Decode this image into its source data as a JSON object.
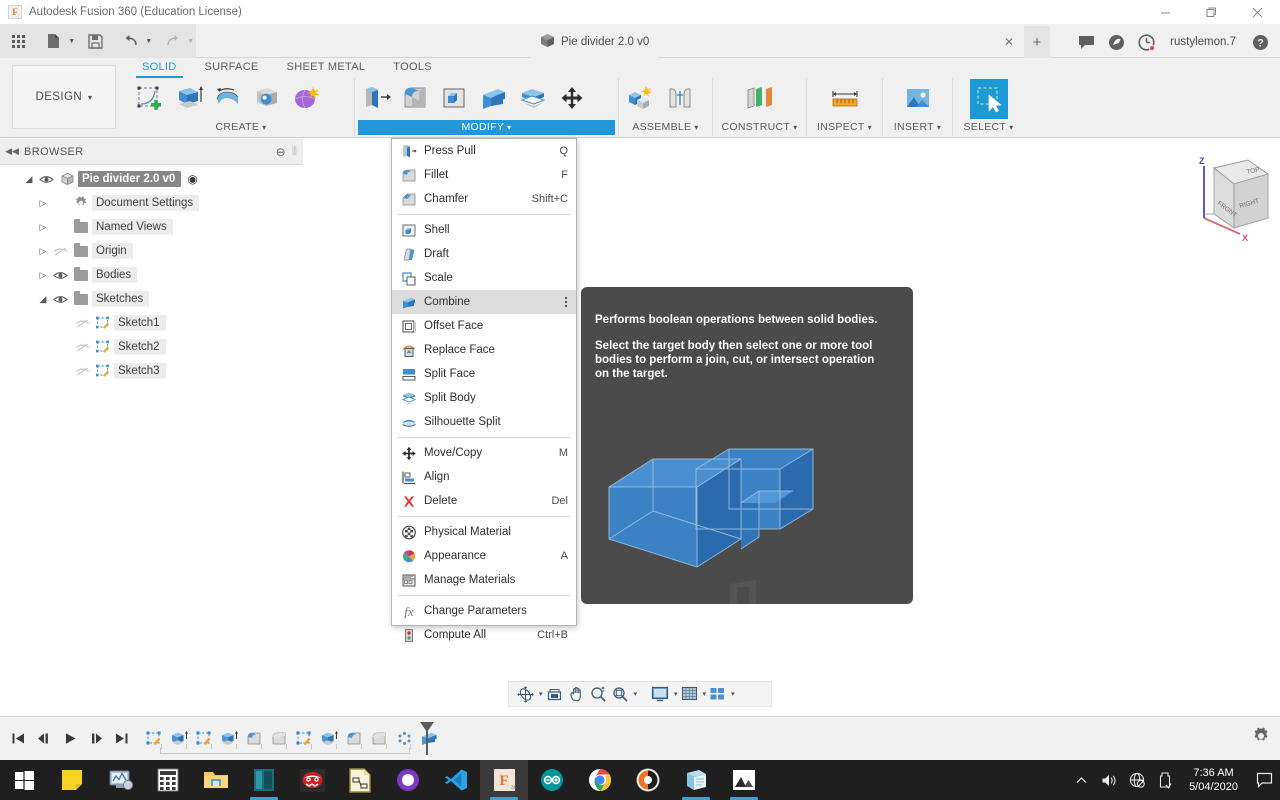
{
  "window": {
    "title": "Autodesk Fusion 360 (Education License)",
    "app_icon": "fusion-logo-icon",
    "minimize": "–",
    "maximize": "❐",
    "close": "✕"
  },
  "quick_access": {
    "app_grid": "app-grid-icon",
    "new_file": "new-file-icon",
    "save": "save-icon",
    "undo": "undo-icon",
    "redo": "redo-icon",
    "caret": "▾"
  },
  "document_tab": {
    "label": "Pie divider 2.0 v0",
    "icon": "component-cube-icon",
    "close": "✕",
    "new_tab": "+"
  },
  "tabbar_right": {
    "comments": "comment-icon",
    "job_status": "job-status-icon",
    "notifications": "notification-clock-icon",
    "user": "rustylemon.7",
    "help": "?"
  },
  "ribbon": {
    "workspace": "DESIGN",
    "workspace_caret": "▾",
    "tabs": [
      {
        "label": "SOLID",
        "active": true
      },
      {
        "label": "SURFACE",
        "active": false
      },
      {
        "label": "SHEET METAL",
        "active": false
      },
      {
        "label": "TOOLS",
        "active": false
      }
    ],
    "panels": [
      {
        "label": "CREATE",
        "caret": "▾",
        "active": false,
        "tools": [
          "create-sketch-icon",
          "extrude-icon",
          "revolve-icon",
          "sweep-icon",
          "form-icon"
        ]
      },
      {
        "label": "MODIFY",
        "caret": "▾",
        "active": true,
        "tools": [
          "press-pull-icon",
          "fillet-icon",
          "shell-icon",
          "combine-icon",
          "split-body-icon",
          "move-copy-icon"
        ]
      },
      {
        "label": "ASSEMBLE",
        "caret": "▾",
        "active": false,
        "tools": [
          "new-component-icon",
          "joint-icon"
        ]
      },
      {
        "label": "CONSTRUCT",
        "caret": "▾",
        "active": false,
        "tools": [
          "offset-plane-icon"
        ]
      },
      {
        "label": "INSPECT",
        "caret": "▾",
        "active": false,
        "tools": [
          "measure-icon"
        ]
      },
      {
        "label": "INSERT",
        "caret": "▾",
        "active": false,
        "tools": [
          "insert-image-icon"
        ]
      },
      {
        "label": "SELECT",
        "caret": "▾",
        "active": false,
        "tools": [
          "select-window-icon"
        ]
      }
    ]
  },
  "browser": {
    "title": "BROWSER",
    "collapse": "◀◀",
    "minus": "⊖",
    "tree": [
      {
        "label": "Pie divider 2.0 v0",
        "arrow": "◢",
        "eye": "visible",
        "icon": "component-cube-icon",
        "indent": 0,
        "root": true,
        "radio": "◉"
      },
      {
        "label": "Document Settings",
        "arrow": "▷",
        "eye": "none",
        "icon": "gear-icon",
        "indent": 1,
        "root": false
      },
      {
        "label": "Named Views",
        "arrow": "▷",
        "eye": "none",
        "icon": "folder-icon",
        "indent": 1,
        "root": false
      },
      {
        "label": "Origin",
        "arrow": "▷",
        "eye": "hidden",
        "icon": "folder-icon",
        "indent": 1,
        "root": false
      },
      {
        "label": "Bodies",
        "arrow": "▷",
        "eye": "visible",
        "icon": "folder-icon",
        "indent": 1,
        "root": false
      },
      {
        "label": "Sketches",
        "arrow": "◢",
        "eye": "visible",
        "icon": "folder-icon",
        "indent": 1,
        "root": false
      },
      {
        "label": "Sketch1",
        "arrow": "",
        "eye": "hidden",
        "icon": "sketch-icon",
        "indent": 2,
        "root": false
      },
      {
        "label": "Sketch2",
        "arrow": "",
        "eye": "hidden",
        "icon": "sketch-icon",
        "indent": 2,
        "root": false
      },
      {
        "label": "Sketch3",
        "arrow": "",
        "eye": "hidden",
        "icon": "sketch-icon",
        "indent": 2,
        "root": false
      }
    ]
  },
  "modify_menu": {
    "items": [
      {
        "label": "Press Pull",
        "shortcut": "Q",
        "icon": "press-pull-icon",
        "sep_after": false,
        "highlighted": false
      },
      {
        "label": "Fillet",
        "shortcut": "F",
        "icon": "fillet-icon",
        "sep_after": false,
        "highlighted": false
      },
      {
        "label": "Chamfer",
        "shortcut": "Shift+C",
        "icon": "chamfer-icon",
        "sep_after": true,
        "highlighted": false
      },
      {
        "label": "Shell",
        "shortcut": "",
        "icon": "shell-icon",
        "sep_after": false,
        "highlighted": false
      },
      {
        "label": "Draft",
        "shortcut": "",
        "icon": "draft-icon",
        "sep_after": false,
        "highlighted": false
      },
      {
        "label": "Scale",
        "shortcut": "",
        "icon": "scale-icon",
        "sep_after": false,
        "highlighted": false
      },
      {
        "label": "Combine",
        "shortcut": "",
        "icon": "combine-icon",
        "sep_after": false,
        "highlighted": true,
        "overflow": "⋮"
      },
      {
        "label": "Offset Face",
        "shortcut": "",
        "icon": "offset-face-icon",
        "sep_after": false,
        "highlighted": false
      },
      {
        "label": "Replace Face",
        "shortcut": "",
        "icon": "replace-face-icon",
        "sep_after": false,
        "highlighted": false
      },
      {
        "label": "Split Face",
        "shortcut": "",
        "icon": "split-face-icon",
        "sep_after": false,
        "highlighted": false
      },
      {
        "label": "Split Body",
        "shortcut": "",
        "icon": "split-body-icon",
        "sep_after": false,
        "highlighted": false
      },
      {
        "label": "Silhouette Split",
        "shortcut": "",
        "icon": "silhouette-split-icon",
        "sep_after": true,
        "highlighted": false
      },
      {
        "label": "Move/Copy",
        "shortcut": "M",
        "icon": "move-copy-icon",
        "sep_after": false,
        "highlighted": false
      },
      {
        "label": "Align",
        "shortcut": "",
        "icon": "align-icon",
        "sep_after": false,
        "highlighted": false
      },
      {
        "label": "Delete",
        "shortcut": "Del",
        "icon": "delete-icon",
        "sep_after": true,
        "highlighted": false
      },
      {
        "label": "Physical Material",
        "shortcut": "",
        "icon": "physical-material-icon",
        "sep_after": false,
        "highlighted": false
      },
      {
        "label": "Appearance",
        "shortcut": "A",
        "icon": "appearance-icon",
        "sep_after": false,
        "highlighted": false
      },
      {
        "label": "Manage Materials",
        "shortcut": "",
        "icon": "manage-materials-icon",
        "sep_after": true,
        "highlighted": false
      },
      {
        "label": "Change Parameters",
        "shortcut": "",
        "icon": "change-parameters-icon",
        "sep_after": false,
        "highlighted": false
      },
      {
        "label": "Compute All",
        "shortcut": "Ctrl+B",
        "icon": "compute-all-icon",
        "sep_after": false,
        "highlighted": false
      }
    ]
  },
  "tooltip": {
    "heading": "Performs boolean operations between solid bodies.",
    "body_line1": "Select the target body then select one or more tool",
    "body_line2": "bodies to perform a join, cut, or intersect operation",
    "body_line3": "on the target.",
    "preview_alt": "combine-preview-illustration"
  },
  "viewcube": {
    "top": "TOP",
    "front": "FRONT",
    "right": "RIGHT",
    "axis_z": "Z",
    "axis_x": "X"
  },
  "navbar": {
    "items": [
      {
        "name": "orbit-icon",
        "caret": "▾"
      },
      {
        "name": "look-at-icon",
        "caret": ""
      },
      {
        "name": "pan-icon",
        "caret": ""
      },
      {
        "name": "zoom-icon",
        "caret": ""
      },
      {
        "name": "fit-icon",
        "caret": "▾"
      },
      {
        "name": "display-settings-icon",
        "caret": "▾"
      },
      {
        "name": "grid-snaps-icon",
        "caret": "▾"
      },
      {
        "name": "viewports-icon",
        "caret": "▾"
      }
    ]
  },
  "timeline": {
    "controls": [
      "skip-to-start-icon",
      "step-back-icon",
      "play-icon",
      "step-forward-icon",
      "skip-to-end-icon"
    ],
    "features": [
      "sketch-feature-icon",
      "extrude-feature-icon",
      "sketch-feature-icon",
      "extrude-feature-icon",
      "fillet-feature-icon",
      "fillet-feature-icon",
      "sketch-feature-icon",
      "extrude-feature-icon",
      "fillet-feature-icon",
      "fillet-feature-icon",
      "pattern-feature-icon",
      "combine-feature-icon"
    ],
    "end_marker": "timeline-end-marker",
    "settings": "gear-icon"
  },
  "taskbar": {
    "start": "windows-start-icon",
    "apps": [
      {
        "name": "sticky-notes-icon",
        "active": false,
        "running": false
      },
      {
        "name": "performance-monitor-icon",
        "active": false,
        "running": false
      },
      {
        "name": "calculator-icon",
        "active": false,
        "running": false
      },
      {
        "name": "file-explorer-icon",
        "active": false,
        "running": true
      },
      {
        "name": "code-editor-icon",
        "active": false,
        "running": false
      },
      {
        "name": "red-app-icon",
        "active": false,
        "running": false
      },
      {
        "name": "libreoffice-draw-icon",
        "active": false,
        "running": false
      },
      {
        "name": "purple-circle-app-icon",
        "active": false,
        "running": false
      },
      {
        "name": "vs-code-icon",
        "active": false,
        "running": false
      },
      {
        "name": "fusion360-icon",
        "active": true,
        "running": true
      },
      {
        "name": "arduino-icon",
        "active": false,
        "running": false
      },
      {
        "name": "chrome-icon",
        "active": false,
        "running": false
      },
      {
        "name": "orange-circle-app-icon",
        "active": false,
        "running": false
      },
      {
        "name": "notepad-app-icon",
        "active": false,
        "running": true
      },
      {
        "name": "photos-icon",
        "active": false,
        "running": true
      }
    ],
    "tray": {
      "show_hidden": "chevron-up-icon",
      "volume": "speaker-icon",
      "network": "network-disabled-icon",
      "usb": "usb-eject-icon",
      "time": "7:36 AM",
      "date": "5/04/2020",
      "action_center": "action-center-icon"
    }
  },
  "colors": {
    "accent_blue": "#1b9ad6",
    "panel_active": "#2196d9",
    "tooltip_bg": "#4b4b4b",
    "model_blue": "#2f72b8",
    "ribbon_bg": "#f0f0f0",
    "taskbar_bg": "#1f1f1f",
    "delete_red": "#e03030",
    "highlight_gray": "#dcdcdc"
  }
}
